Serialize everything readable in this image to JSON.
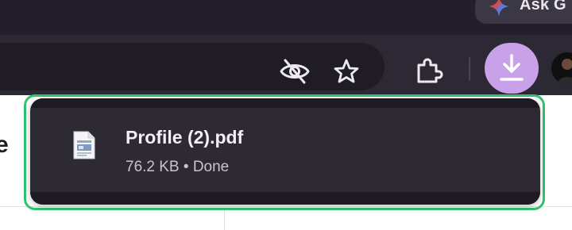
{
  "tabstrip": {
    "ask_button": {
      "label": "Ask G",
      "icon": "gemini-star-icon"
    }
  },
  "toolbar": {
    "icons": [
      "eye-off-icon",
      "star-icon",
      "puzzle-icon",
      "download-icon"
    ],
    "download_accent": "#c8a1e8"
  },
  "page": {
    "visible_text": "e"
  },
  "download_bubble": {
    "highlight_color": "#34c26e",
    "item": {
      "file_name": "Profile (2).pdf",
      "size": "76.2 KB",
      "separator": "•",
      "status": "Done",
      "icon": "pdf-file-icon"
    }
  }
}
